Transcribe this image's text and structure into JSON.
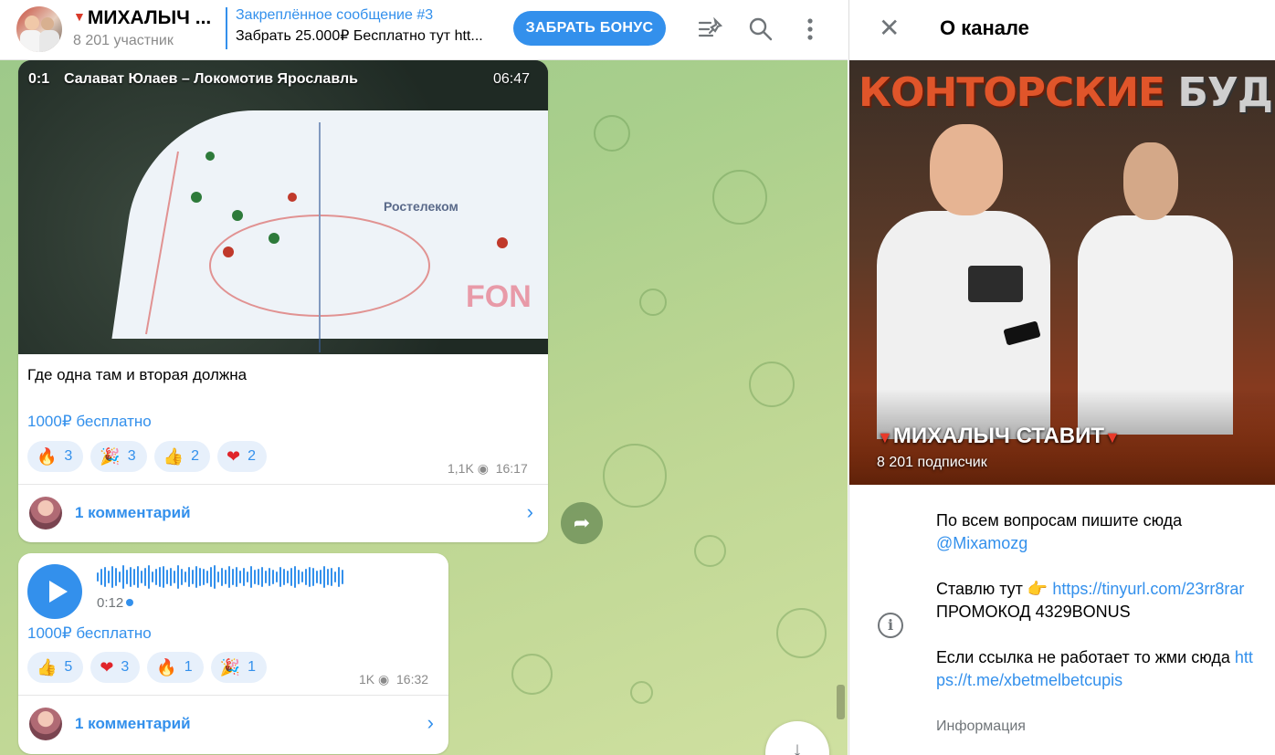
{
  "header": {
    "channel_title": "МИХАЛЫЧ ...",
    "channel_title_icon": "red-triangle",
    "members": "8 201 участник",
    "pinned_label": "Закреплённое сообщение #3",
    "pinned_text": "Забрать 25.000₽ Бесплатно тут htt...",
    "bonus_button": "ЗАБРАТЬ БОНУС",
    "icons": [
      "pinned-list-icon",
      "search-icon",
      "more-icon"
    ]
  },
  "messages": [
    {
      "video": {
        "score": "0:1",
        "match": "Салават Юлаев – Локомотив Ярославль",
        "duration": "06:47"
      },
      "text": "Где одна там и вторая должна",
      "link_text": "1000₽ бесплатно",
      "reactions": [
        {
          "emoji": "🔥",
          "count": "3"
        },
        {
          "emoji": "🎉",
          "count": "3"
        },
        {
          "emoji": "👍",
          "count": "2"
        },
        {
          "emoji": "❤",
          "count": "2"
        }
      ],
      "views": "1,1K",
      "time": "16:17",
      "comments": "1 комментарий"
    },
    {
      "voice": {
        "duration": "0:12"
      },
      "link_text": "1000₽ бесплатно",
      "reactions": [
        {
          "emoji": "👍",
          "count": "5"
        },
        {
          "emoji": "❤",
          "count": "3"
        },
        {
          "emoji": "🔥",
          "count": "1"
        },
        {
          "emoji": "🎉",
          "count": "1"
        }
      ],
      "views": "1K",
      "time": "16:32",
      "comments": "1 комментарий"
    }
  ],
  "panel": {
    "title": "О канале",
    "cover_banner_a": "КОНТОРСКИЕ",
    "cover_banner_b": "БУДНИ",
    "channel_name": "МИХАЛЫЧ СТАВИТ",
    "subscribers": "8 201 подписчик",
    "description": {
      "line1": "По всем вопросам пишите сюда",
      "contact": "@Mixamozg",
      "bet_prefix": "Ставлю тут 👉 ",
      "bet_link": "https://tinyurl.com/23rr8rar",
      "promo": "ПРОМОКОД 4329BONUS",
      "fallback_text": "Если ссылка не работает то жми сюда ",
      "fallback_link": "https://t.me/xbetmelbetcupis"
    },
    "info_label": "Информация"
  },
  "colors": {
    "accent": "#3390ec",
    "reaction_bg": "#e7f0fb",
    "chat_bg": "#a9cf8c"
  }
}
